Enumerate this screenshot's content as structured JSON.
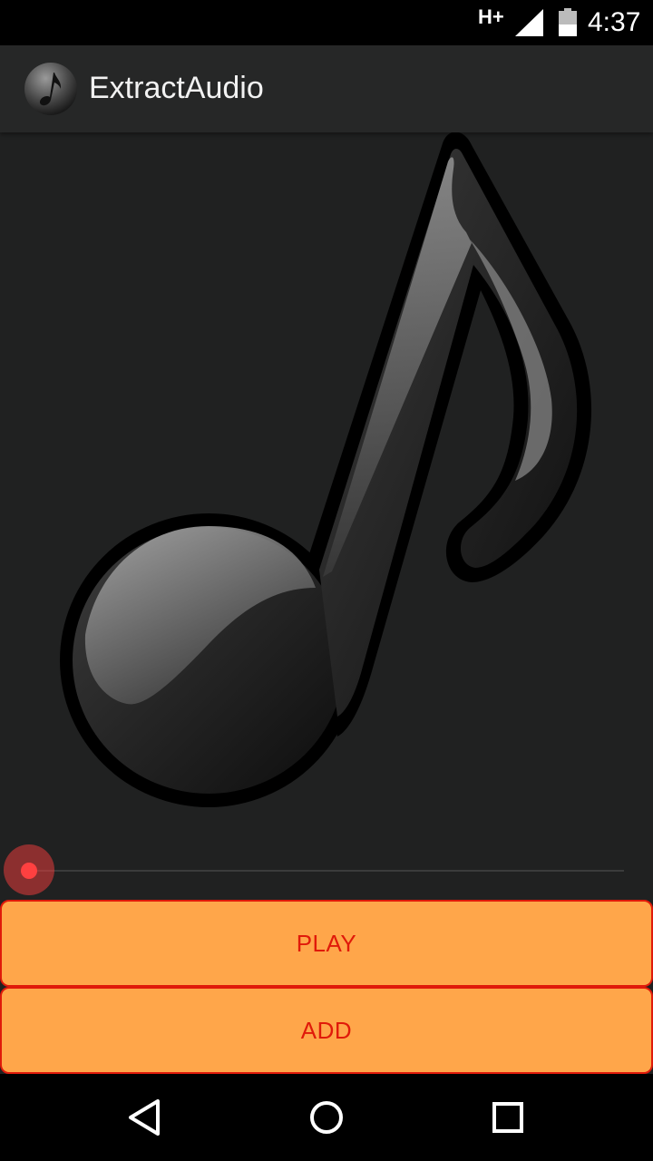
{
  "status_bar": {
    "network": "H+",
    "time": "4:37",
    "icons": [
      "signal-icon",
      "battery-icon"
    ]
  },
  "app_bar": {
    "title": "ExtractAudio",
    "logo_icon": "music-note-icon"
  },
  "main": {
    "artwork_icon": "music-note-icon",
    "seekbar": {
      "progress": 0
    }
  },
  "buttons": {
    "play_label": "PLAY",
    "add_label": "ADD"
  },
  "nav_bar": {
    "icons": [
      "back-icon",
      "home-icon",
      "recents-icon"
    ]
  },
  "colors": {
    "background": "#202121",
    "app_bar": "#262727",
    "button_fill": "#ffa64a",
    "button_text": "#e01a0a",
    "seek_thumb": "#ff4040"
  }
}
